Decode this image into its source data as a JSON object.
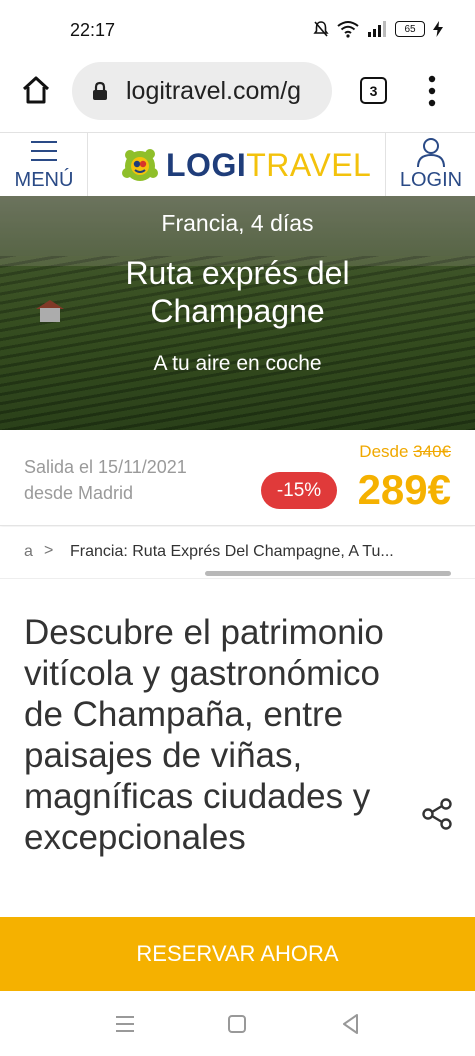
{
  "status_bar": {
    "time": "22:17",
    "battery": "65",
    "icons": [
      "mute-icon",
      "wifi-icon",
      "signal-icon",
      "battery-icon",
      "charging-icon"
    ]
  },
  "browser": {
    "url": "logitravel.com/g",
    "tab_count": "3",
    "icons": [
      "home-icon",
      "lock-icon",
      "more-icon"
    ]
  },
  "site_header": {
    "menu_label": "MENÚ",
    "logo_logi": "LOGI",
    "logo_travel": "TRAVEL",
    "login_label": "LOGIN",
    "colors": {
      "brand_blue": "#1f3d7a",
      "brand_yellow": "#f3c20c"
    }
  },
  "hero": {
    "eyebrow": "Francia, 4 días",
    "title": "Ruta exprés del Champagne",
    "subtitle": "A tu aire en coche"
  },
  "price_panel": {
    "departure_line1": "Salida el 15/11/2021",
    "departure_line2": "desde Madrid",
    "from_label": "Desde",
    "old_price": "340€",
    "discount": "-15%",
    "price": "289€",
    "colors": {
      "price": "#f5b100",
      "discount_bg": "#e03a3a"
    }
  },
  "breadcrumb": {
    "first": "a",
    "separator": ">",
    "current": "Francia: Ruta Exprés Del Champagne, A Tu..."
  },
  "description": {
    "text": "Descubre el patrimonio vitícola y gastronómico de Champaña, entre paisajes de viñas, magníficas ciudades y excepcionales"
  },
  "cta": {
    "label": "RESERVAR AHORA",
    "color": "#f5b100"
  },
  "nav_bar": {
    "icons": [
      "recents-icon",
      "home-icon",
      "back-icon"
    ]
  }
}
